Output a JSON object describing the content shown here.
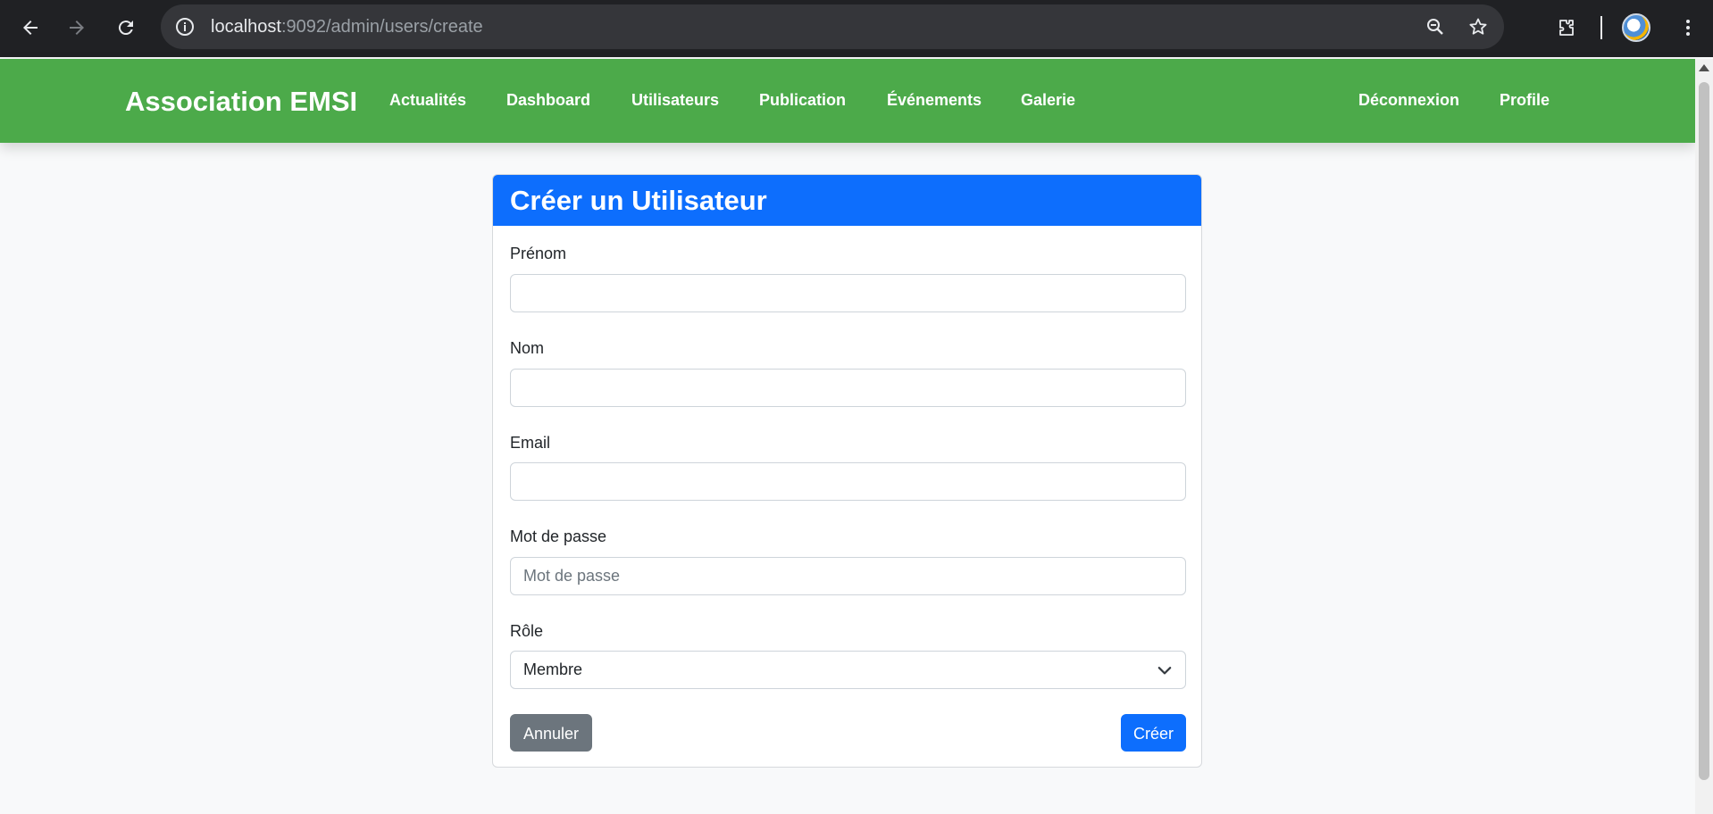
{
  "browser": {
    "url_host": "localhost",
    "url_path": ":9092/admin/users/create"
  },
  "navbar": {
    "brand": "Association EMSI",
    "links": [
      "Actualités",
      "Dashboard",
      "Utilisateurs",
      "Publication",
      "Événements",
      "Galerie"
    ],
    "right_links": [
      "Déconnexion",
      "Profile"
    ],
    "color": "#4caa4a"
  },
  "form": {
    "title": "Créer un Utilisateur",
    "header_color": "#0d6efd",
    "fields": {
      "first_name": {
        "label": "Prénom",
        "value": "",
        "placeholder": ""
      },
      "last_name": {
        "label": "Nom",
        "value": "",
        "placeholder": ""
      },
      "email": {
        "label": "Email",
        "value": "",
        "placeholder": ""
      },
      "password": {
        "label": "Mot de passe",
        "value": "",
        "placeholder": "Mot de passe"
      },
      "role": {
        "label": "Rôle",
        "selected": "Membre"
      }
    },
    "cancel_label": "Annuler",
    "submit_label": "Créer"
  }
}
